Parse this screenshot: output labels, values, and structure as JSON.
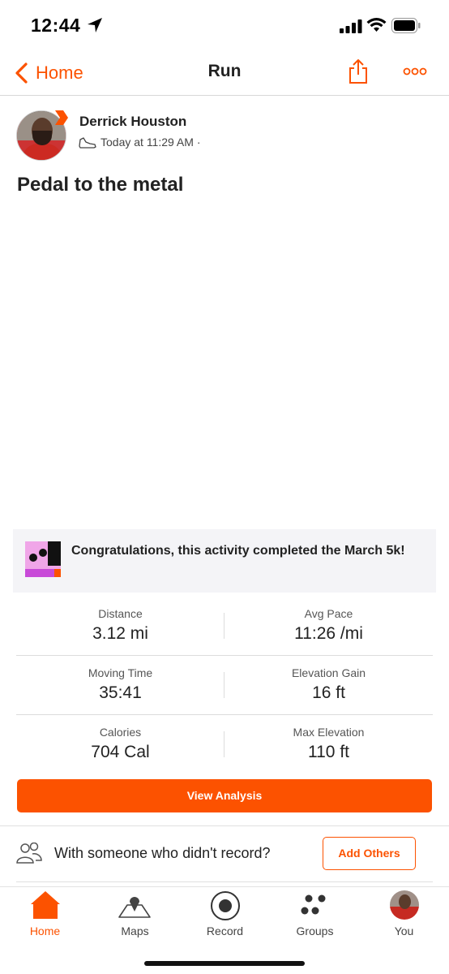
{
  "status_bar": {
    "time": "12:44"
  },
  "nav": {
    "back_label": "Home",
    "title": "Run"
  },
  "athlete": {
    "name": "Derrick Houston",
    "meta_time": "Today at 11:29 AM ·"
  },
  "activity": {
    "title": "Pedal to the metal"
  },
  "challenge": {
    "text": "Congratulations, this activity completed the March 5k!"
  },
  "stats": [
    {
      "left_label": "Distance",
      "left_value": "3.12 mi",
      "right_label": "Avg Pace",
      "right_value": "11:26 /mi"
    },
    {
      "left_label": "Moving Time",
      "left_value": "35:41",
      "right_label": "Elevation Gain",
      "right_value": "16 ft"
    },
    {
      "left_label": "Calories",
      "left_value": "704 Cal",
      "right_label": "Max Elevation",
      "right_value": "110 ft"
    }
  ],
  "actions": {
    "view_analysis": "View Analysis",
    "with_someone": "With someone who didn't record?",
    "add_others": "Add Others"
  },
  "tabs": [
    {
      "label": "Home",
      "icon": "home-icon",
      "active": true
    },
    {
      "label": "Maps",
      "icon": "maps-icon"
    },
    {
      "label": "Record",
      "icon": "record-icon"
    },
    {
      "label": "Groups",
      "icon": "groups-icon"
    },
    {
      "label": "You",
      "icon": "avatar"
    }
  ],
  "colors": {
    "accent": "#fc5200",
    "text": "#222222",
    "muted": "#555555"
  }
}
